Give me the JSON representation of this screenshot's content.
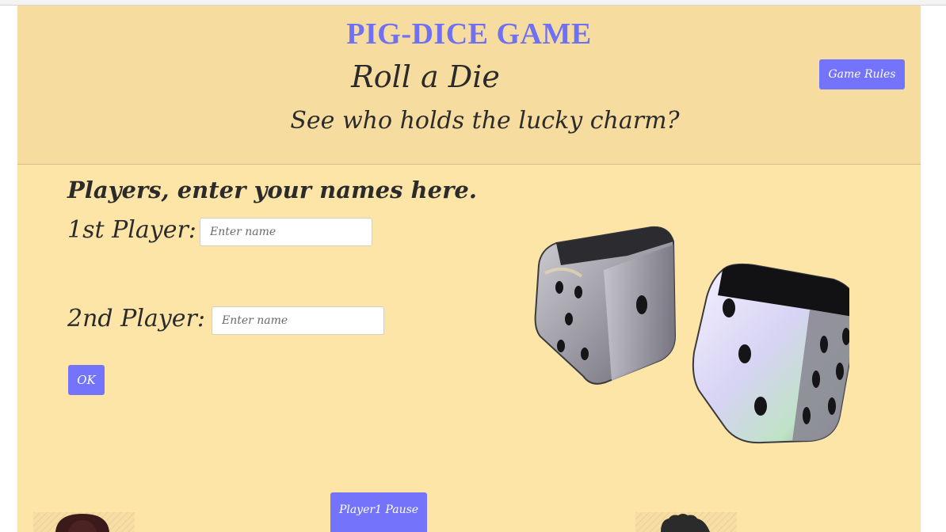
{
  "header": {
    "title": "PIG-DICE GAME",
    "subtitle": "Roll a Die",
    "tagline": "See who holds the lucky charm?",
    "rules_button": "Game Rules"
  },
  "players": {
    "prompt": "Players, enter your names here.",
    "player1_label": "1st Player:",
    "player1_placeholder": "Enter name",
    "player2_label": "2nd Player:",
    "player2_placeholder": "Enter name",
    "ok_button": "OK"
  },
  "controls": {
    "player1_pause": "Player1 Pause"
  },
  "icons": {
    "dice": "dice-illustration",
    "player1": "player1-avatar",
    "player2": "player2-avatar"
  },
  "colors": {
    "accent": "#7373fb",
    "title": "#7070f2",
    "header_bg": "#f6dd9f",
    "page_bg": "#fde5a8"
  }
}
